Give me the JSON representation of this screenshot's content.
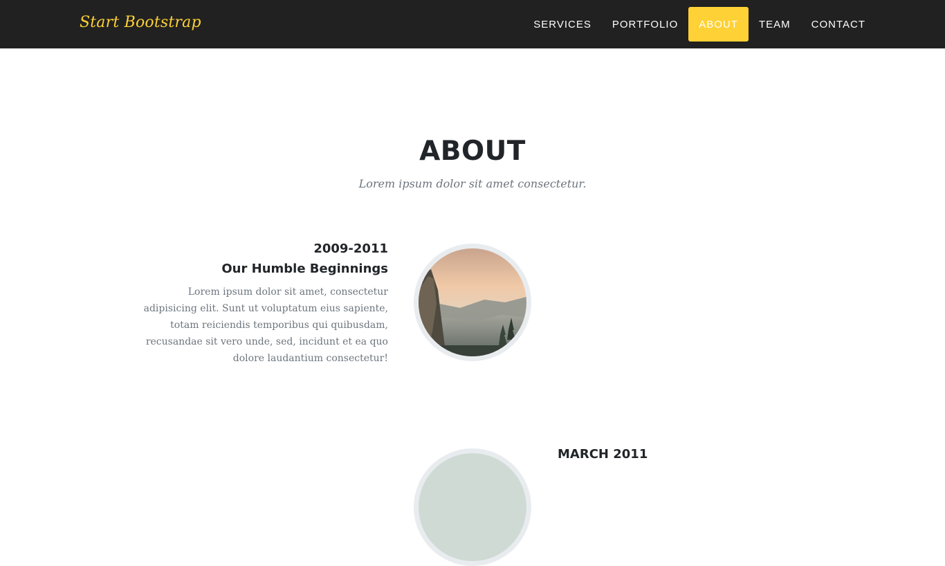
{
  "navbar": {
    "brand": "Start Bootstrap",
    "items": [
      {
        "label": "Services",
        "active": false
      },
      {
        "label": "Portfolio",
        "active": false
      },
      {
        "label": "About",
        "active": true
      },
      {
        "label": "Team",
        "active": false
      },
      {
        "label": "Contact",
        "active": false
      }
    ],
    "accent_color": "#fed136",
    "background_color": "#212121"
  },
  "about": {
    "title": "ABOUT",
    "subtitle": "Lorem ipsum dolor sit amet consectetur.",
    "timeline": [
      {
        "year": "2009-2011",
        "title": "Our Humble Beginnings",
        "body": "Lorem ipsum dolor sit amet, consectetur adipisicing elit. Sunt ut voluptatum eius sapiente, totam reiciendis temporibus qui quibusdam, recusandae sit vero unde, sed, incidunt et ea quo dolore laudantium consectetur!",
        "image": "mountain-valley-image"
      },
      {
        "year": "MARCH 2011",
        "image": "timeline-image-2"
      }
    ]
  }
}
